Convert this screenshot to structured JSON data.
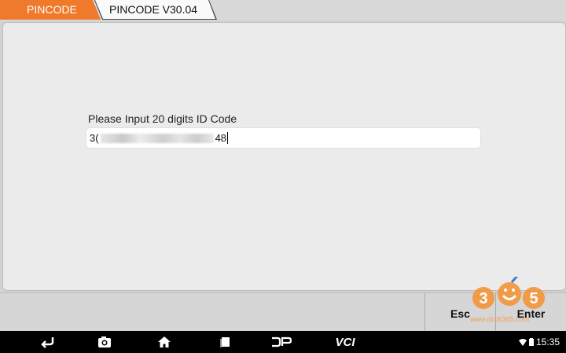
{
  "tabs": [
    {
      "label": "PINCODE"
    },
    {
      "label": "PINCODE V30.04"
    }
  ],
  "form": {
    "prompt": "Please Input 20 digits ID Code",
    "value_start": "3(",
    "value_end": "48"
  },
  "buttons": {
    "esc": "Esc",
    "enter": "Enter"
  },
  "watermark": {
    "digits": [
      "3",
      "6",
      "5"
    ],
    "url": "www.obdii365.com"
  },
  "navbar": {
    "icons": [
      "back-icon",
      "camera-icon",
      "home-icon",
      "recent-apps-icon",
      "dp-icon",
      "vci-icon"
    ],
    "dp_label": "DP",
    "vci_label": "VCI",
    "time": "15:35"
  },
  "colors": {
    "accent": "#ef7a2b"
  }
}
